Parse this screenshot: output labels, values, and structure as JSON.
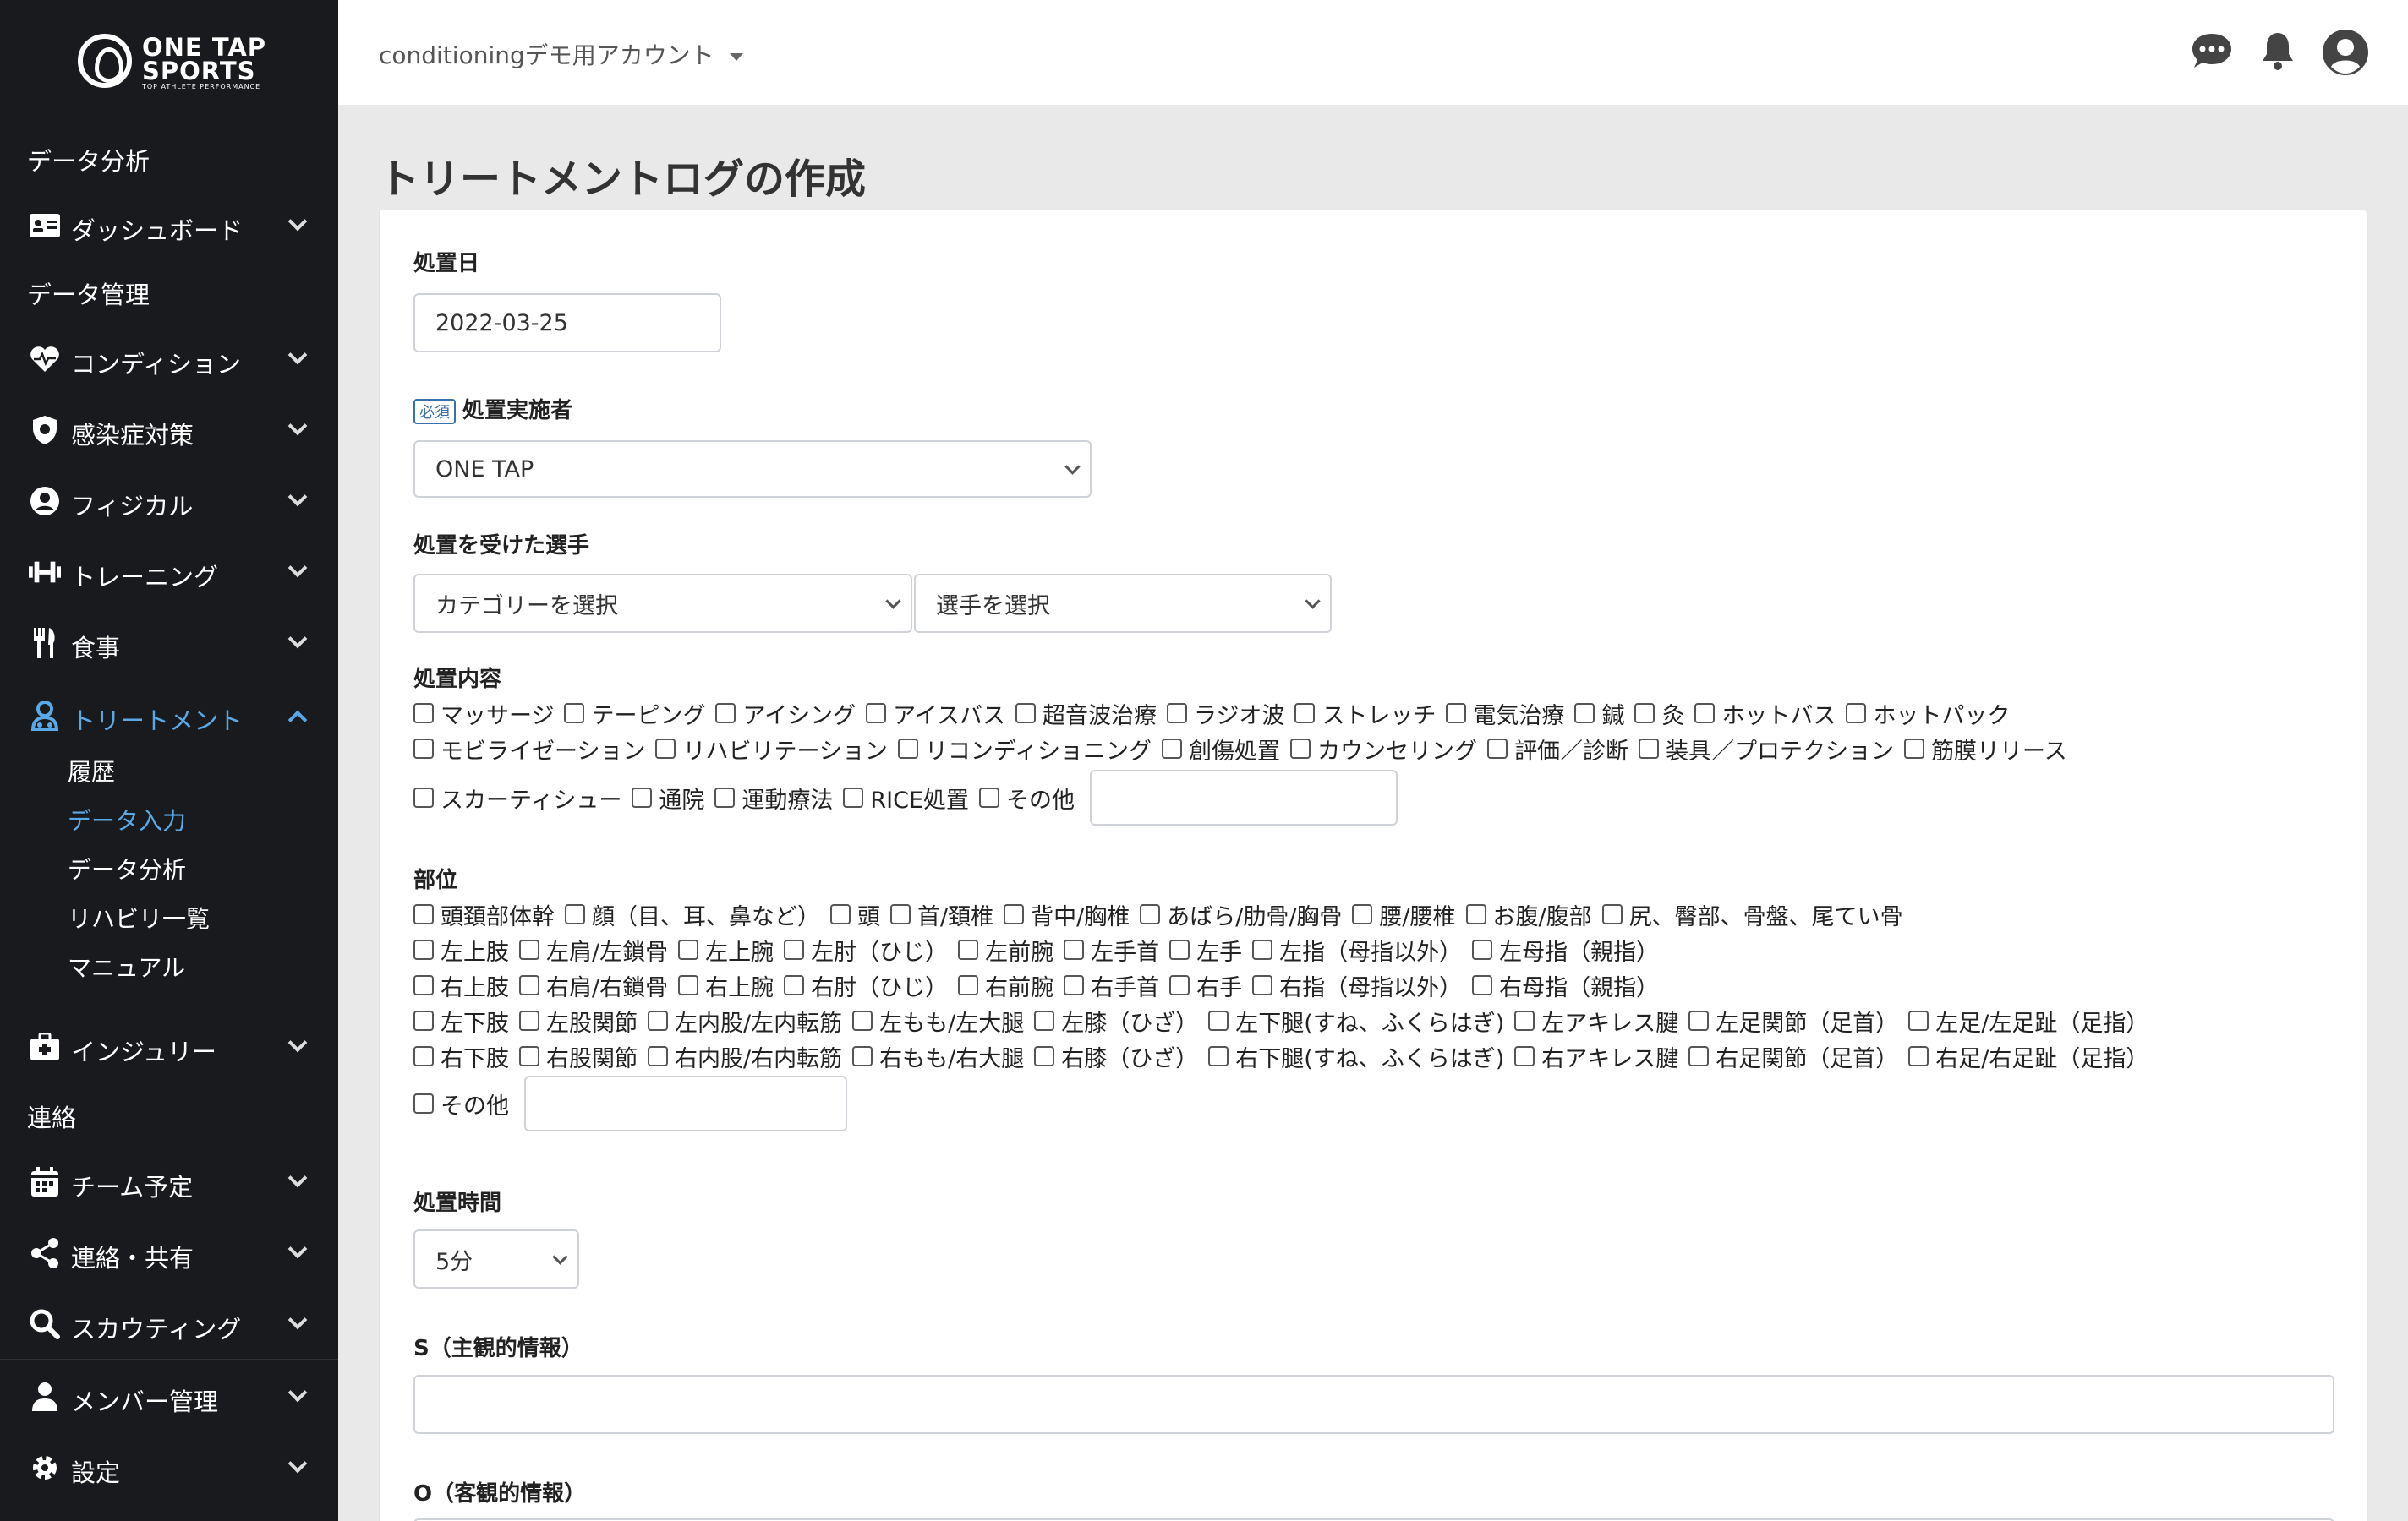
{
  "brand": {
    "line1": "ONE TAP",
    "line2": "SPORTS",
    "tagline": "TOP ATHLETE PERFORMANCE"
  },
  "sidebar": {
    "sections": {
      "analysis": "データ分析",
      "management": "データ管理",
      "contact": "連絡"
    },
    "items": {
      "dashboard": "ダッシュボード",
      "condition": "コンディション",
      "infection": "感染症対策",
      "physical": "フィジカル",
      "training": "トレーニング",
      "meal": "食事",
      "treatment": "トリートメント",
      "injury": "インジュリー",
      "schedule": "チーム予定",
      "share": "連絡・共有",
      "scouting": "スカウティング",
      "members": "メンバー管理",
      "settings": "設定"
    },
    "treatment_sub": [
      "履歴",
      "データ入力",
      "データ分析",
      "リハビリ一覧",
      "マニュアル"
    ]
  },
  "header": {
    "account": "conditioningデモ用アカウント"
  },
  "page": {
    "title": "トリートメントログの作成"
  },
  "form": {
    "date": {
      "label": "処置日",
      "value": "2022-03-25"
    },
    "practitioner": {
      "required_badge": "必須",
      "label": "処置実施者",
      "value": "ONE TAP"
    },
    "athlete": {
      "label": "処置を受けた選手",
      "category": "カテゴリーを選択",
      "player": "選手を選択"
    },
    "contents": {
      "label": "処置内容",
      "row1": [
        "マッサージ",
        "テーピング",
        "アイシング",
        "アイスバス",
        "超音波治療",
        "ラジオ波",
        "ストレッチ",
        "電気治療",
        "鍼",
        "灸",
        "ホットバス",
        "ホットパック"
      ],
      "row2": [
        "モビライゼーション",
        "リハビリテーション",
        "リコンディショニング",
        "創傷処置",
        "カウンセリング",
        "評価／診断",
        "装具／プロテクション",
        "筋膜リリース"
      ],
      "row3": [
        "スカーティシュー",
        "通院",
        "運動療法",
        "RICE処置",
        "その他"
      ]
    },
    "parts": {
      "label": "部位",
      "row1": [
        "頭頚部体幹",
        "顔（目、耳、鼻など）",
        "頭",
        "首/頚椎",
        "背中/胸椎",
        "あばら/肋骨/胸骨",
        "腰/腰椎",
        "お腹/腹部",
        "尻、臀部、骨盤、尾てい骨"
      ],
      "row2": [
        "左上肢",
        "左肩/左鎖骨",
        "左上腕",
        "左肘（ひじ）",
        "左前腕",
        "左手首",
        "左手",
        "左指（母指以外）",
        "左母指（親指）"
      ],
      "row3": [
        "右上肢",
        "右肩/右鎖骨",
        "右上腕",
        "右肘（ひじ）",
        "右前腕",
        "右手首",
        "右手",
        "右指（母指以外）",
        "右母指（親指）"
      ],
      "row4": [
        "左下肢",
        "左股関節",
        "左内股/左内転筋",
        "左もも/左大腿",
        "左膝（ひざ）",
        "左下腿(すね、ふくらはぎ)",
        "左アキレス腱",
        "左足関節（足首）",
        "左足/左足趾（足指）"
      ],
      "row5": [
        "右下肢",
        "右股関節",
        "右内股/右内転筋",
        "右もも/右大腿",
        "右膝（ひざ）",
        "右下腿(すね、ふくらはぎ)",
        "右アキレス腱",
        "右足関節（足首）",
        "右足/右足趾（足指）"
      ],
      "other": "その他"
    },
    "duration": {
      "label": "処置時間",
      "value": "5分"
    },
    "subjective": {
      "label": "S（主観的情報）",
      "value": ""
    },
    "objective": {
      "label": "O（客観的情報）"
    }
  },
  "colors": {
    "sidebar_bg": "#181a1d",
    "accent": "#5aa9e6",
    "page_bg": "#e9e9e9"
  }
}
